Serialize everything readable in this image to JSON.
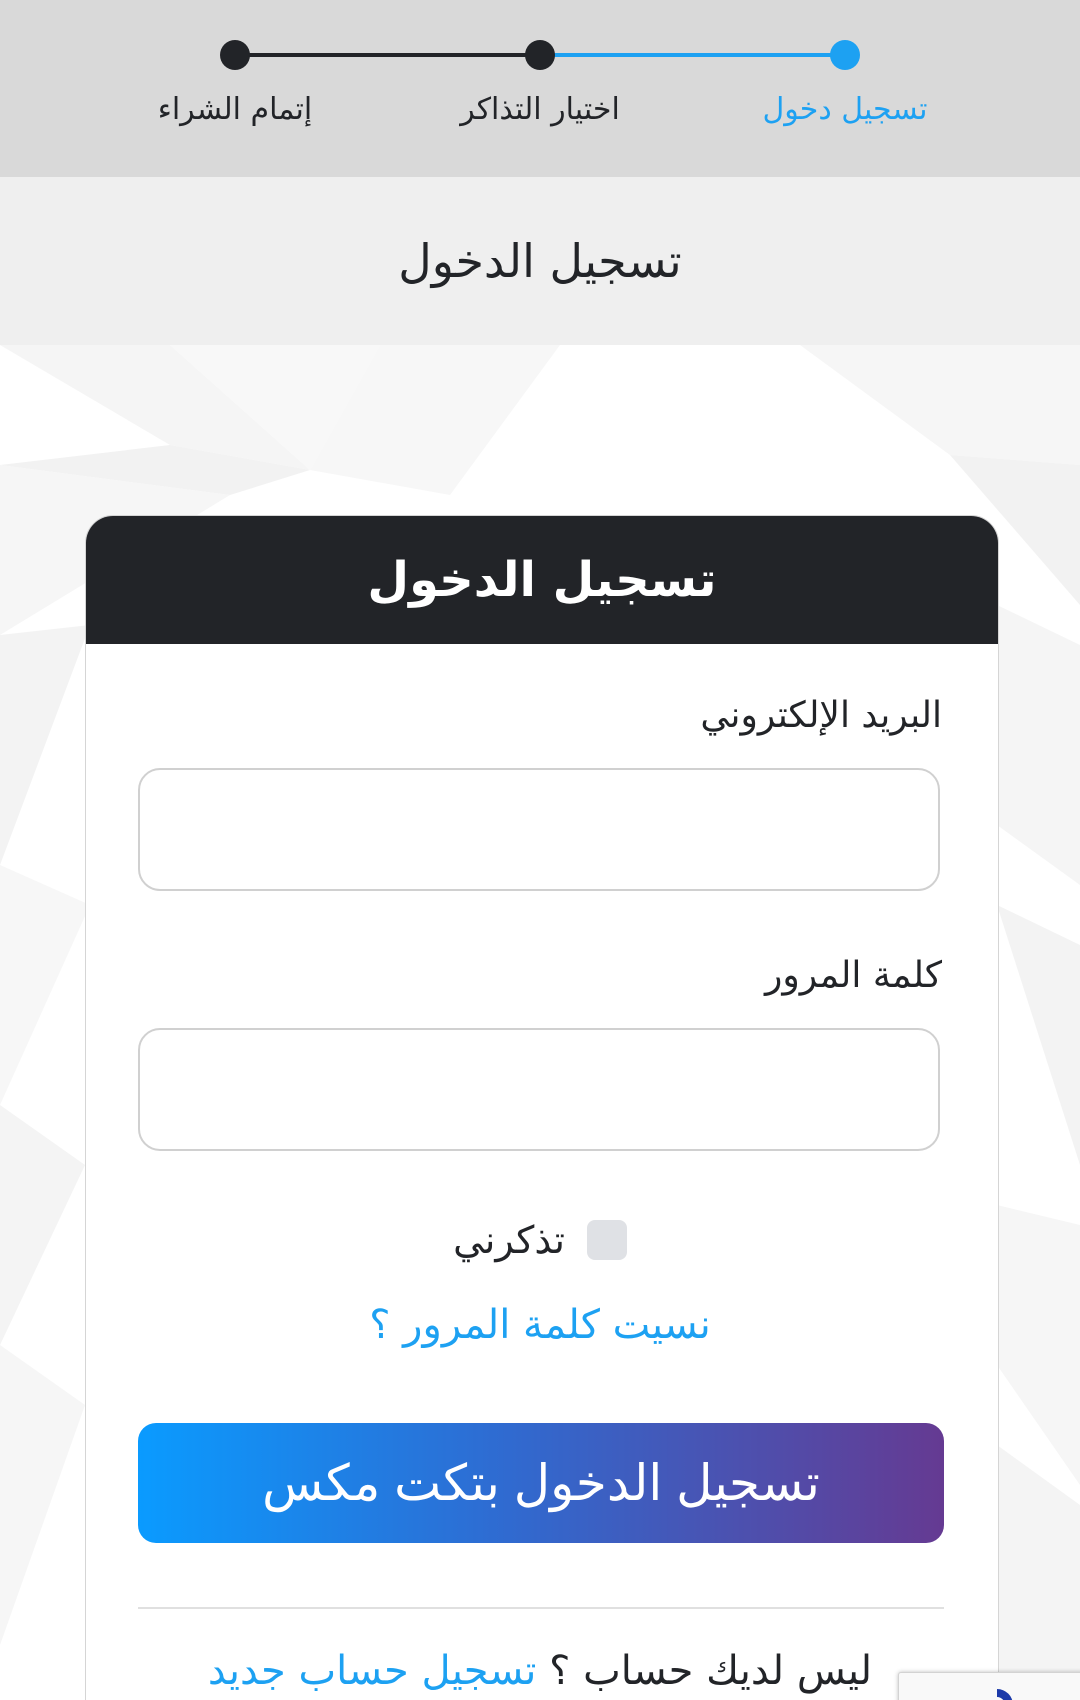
{
  "stepper": {
    "steps": [
      {
        "label": "تسجيل دخول",
        "active": true
      },
      {
        "label": "اختيار التذاكر",
        "active": false
      },
      {
        "label": "إتمام الشراء",
        "active": false
      }
    ]
  },
  "page": {
    "title": "تسجيل الدخول"
  },
  "login_card": {
    "title": "تسجيل الدخول",
    "email_label": "البريد الإلكتروني",
    "email_value": "",
    "password_label": "كلمة المرور",
    "password_value": "",
    "remember_label": "تذكرني",
    "remember_checked": false,
    "forgot_link": "نسيت كلمة المرور ؟",
    "submit_label": "تسجيل الدخول بتكت مكس",
    "register_prompt": "ليس لديك حساب ؟",
    "register_link": "تسجيل حساب جديد"
  },
  "colors": {
    "accent": "#1da1f2",
    "dark": "#222428",
    "gradient_start": "#0a9bff",
    "gradient_end": "#653a92"
  },
  "icons": {
    "recaptcha": "recaptcha-icon"
  }
}
